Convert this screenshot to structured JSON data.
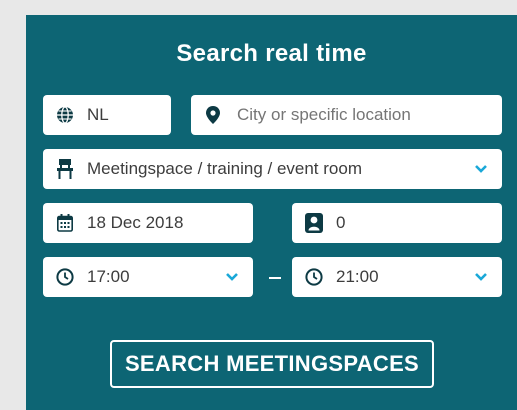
{
  "search": {
    "title": "Search real time",
    "country": {
      "value": "NL",
      "icon": "globe-icon"
    },
    "location": {
      "placeholder": "City or specific location",
      "icon": "map-pin-icon"
    },
    "space_type": {
      "value": "Meetingspace / training / event room",
      "icon": "chair-icon",
      "dropdown_icon": "chevron-down-icon"
    },
    "date": {
      "value": "18 Dec 2018",
      "icon": "calendar-icon"
    },
    "persons": {
      "value": "0",
      "icon": "person-icon"
    },
    "time_from": {
      "value": "17:00",
      "icon": "clock-icon",
      "dropdown_icon": "chevron-down-icon"
    },
    "time_to": {
      "value": "21:00",
      "icon": "clock-icon",
      "dropdown_icon": "chevron-down-icon"
    },
    "submit_label": "SEARCH MEETINGSPACES"
  },
  "colors": {
    "panel": "#0d6574",
    "page_bg": "#e8e8e8",
    "icon": "#0d3a44",
    "accent": "#1aa8d8"
  }
}
